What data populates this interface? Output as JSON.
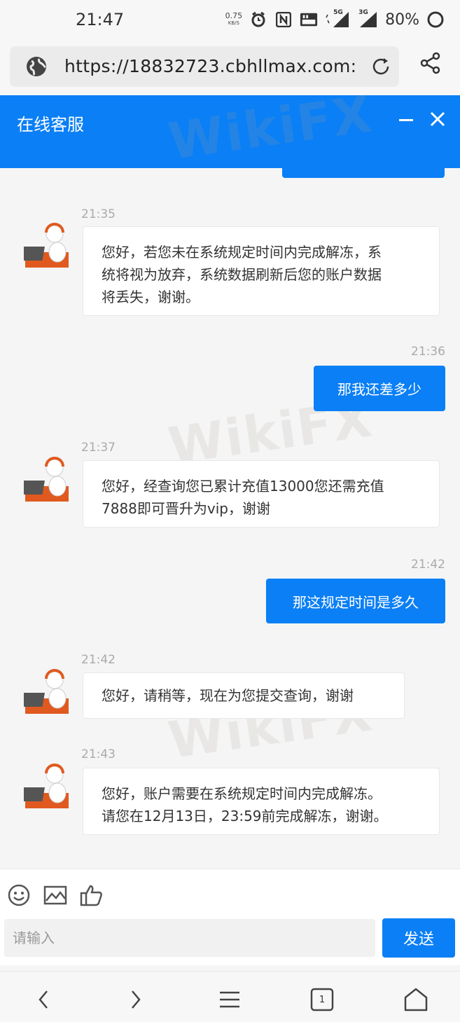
{
  "status_bar": {
    "time": "21:47",
    "net_speed": "0.75",
    "net_speed_unit": "KB/S",
    "network_5g": "5G",
    "network_3g": "3G",
    "battery": "80%"
  },
  "browser": {
    "url": "https://18832723.cbhllmax.com:",
    "tab_count": "1"
  },
  "chat": {
    "title": "在线客服",
    "watermark": "WikiFX",
    "messages": [
      {
        "side": "left",
        "time": "21:35",
        "lines": [
          "您好，若您未在系统规定时间内完成解冻，系",
          "统将视为放弃，系统数据刷新后您的账户数据",
          "将丢失，谢谢。"
        ]
      },
      {
        "side": "right",
        "time": "21:36",
        "text": "那我还差多少"
      },
      {
        "side": "left",
        "time": "21:37",
        "lines": [
          "您好，经查询您已累计充值13000您还需充值",
          "7888即可晋升为vip，谢谢"
        ]
      },
      {
        "side": "right",
        "time": "21:42",
        "text": "那这规定时间是多久"
      },
      {
        "side": "left",
        "time": "21:42",
        "lines": [
          "您好，请稍等，现在为您提交查询，谢谢"
        ]
      },
      {
        "side": "left",
        "time": "21:43",
        "lines": [
          "您好，账户需要在系统规定时间内完成解冻。",
          "请您在12月13日，23:59前完成解冻，谢谢。"
        ]
      }
    ]
  },
  "composer": {
    "placeholder": "请输入",
    "send_label": "发送"
  },
  "colors": {
    "accent": "#0b7ff5"
  }
}
